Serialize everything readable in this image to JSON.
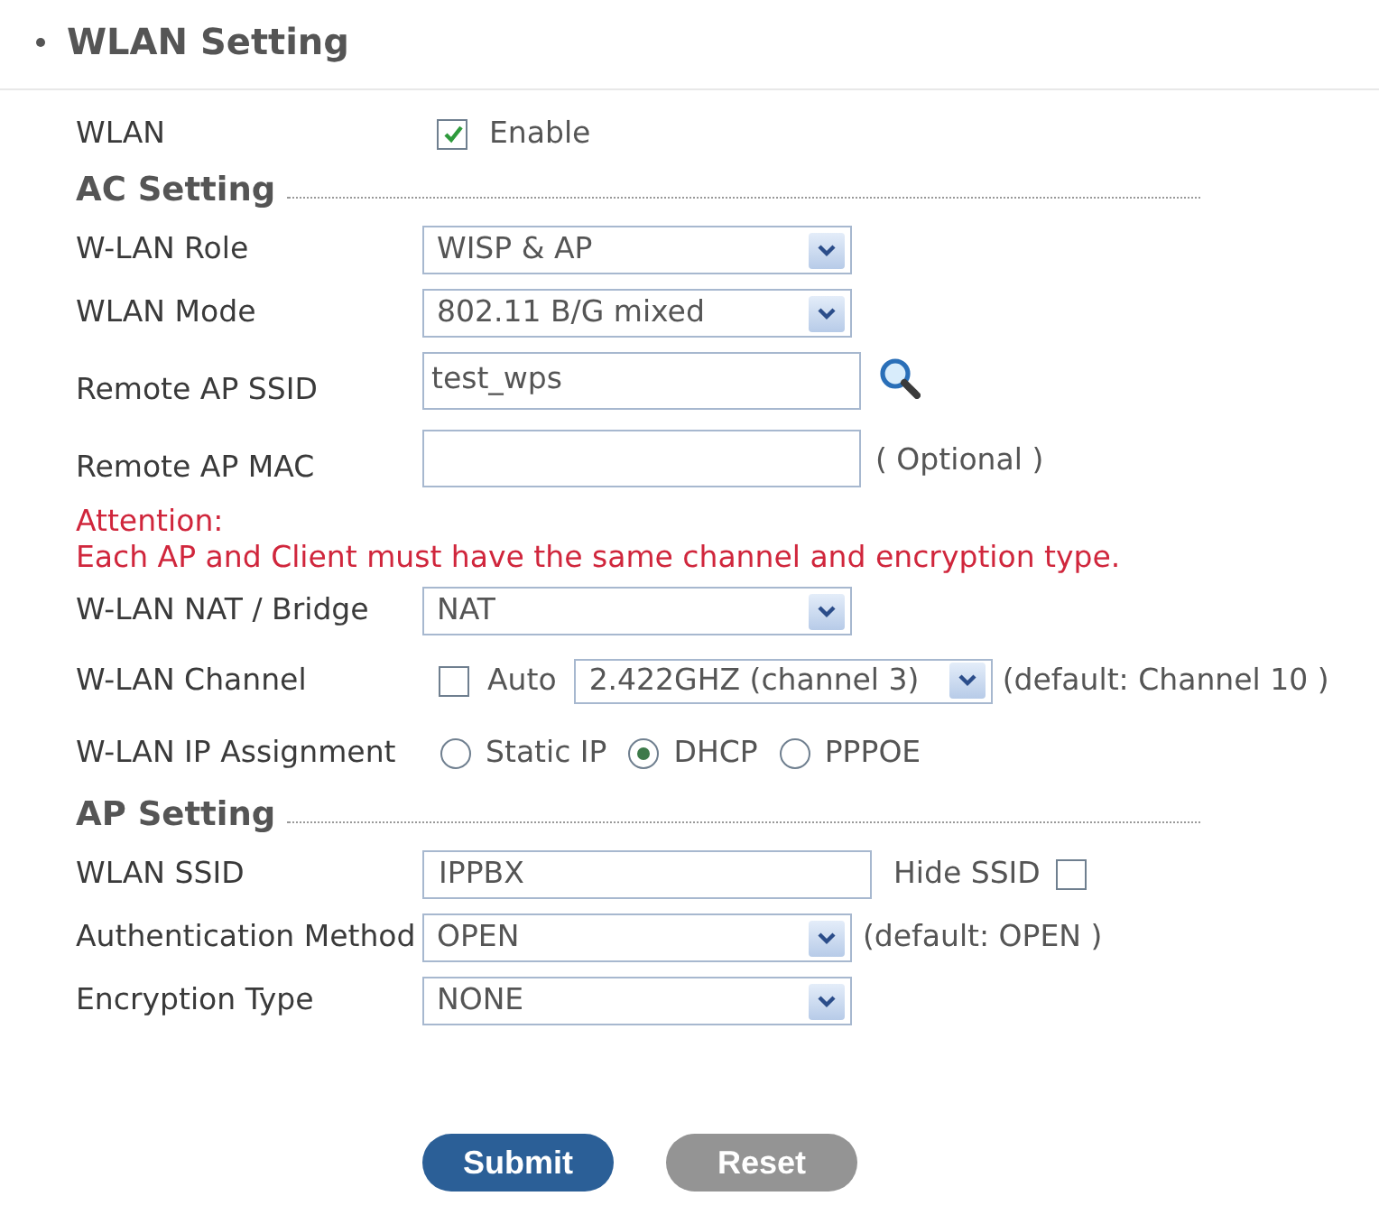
{
  "page": {
    "title": "WLAN Setting"
  },
  "rows": [
    {
      "kind": "checkbox",
      "label": "WLAN",
      "option": "Enable",
      "checked": true
    },
    {
      "kind": "section",
      "title": "AC Setting"
    },
    {
      "kind": "select",
      "label": "W-LAN Role",
      "value": "WISP & AP"
    },
    {
      "kind": "select",
      "label": "WLAN Mode",
      "value": "802.11 B/G mixed"
    },
    {
      "kind": "input",
      "label": "Remote AP SSID",
      "value": "test_wps",
      "search": true
    },
    {
      "kind": "input",
      "label": "Remote AP MAC",
      "note": "( Optional )"
    },
    {
      "kind": "notice",
      "title": "Attention:",
      "text": "Each AP and Client must have the same channel and encryption type."
    },
    {
      "kind": "select",
      "label": "W-LAN NAT / Bridge",
      "value": "NAT"
    },
    {
      "kind": "channel",
      "label": "W-LAN Channel",
      "auto": {
        "label": "Auto",
        "checked": false
      },
      "value": "2.422GHZ (channel 3)",
      "note": "(default: Channel 10 )"
    },
    {
      "kind": "radio",
      "label": "W-LAN IP Assignment",
      "options": [
        {
          "label": "Static IP",
          "selected": false
        },
        {
          "label": "DHCP",
          "selected": true
        },
        {
          "label": "PPPOE",
          "selected": false
        }
      ]
    },
    {
      "kind": "section",
      "title": "AP Setting"
    },
    {
      "kind": "ssid",
      "label": "WLAN SSID",
      "value": "IPPBX",
      "checkbox": {
        "label": "Hide SSID",
        "checked": false
      }
    },
    {
      "kind": "select",
      "label": "Authentication Method",
      "value": "OPEN",
      "note": "(default: OPEN )"
    },
    {
      "kind": "select",
      "label": "Encryption Type",
      "value": "NONE"
    }
  ],
  "buttons": [
    {
      "label": "Submit",
      "disabled": false
    },
    {
      "label": "Reset",
      "disabled": true
    }
  ]
}
